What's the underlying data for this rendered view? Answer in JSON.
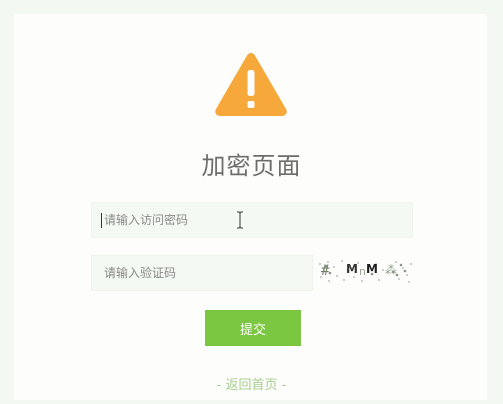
{
  "page": {
    "title": "加密页面"
  },
  "form": {
    "password_placeholder": "请输入访问密码",
    "captcha_placeholder": "请输入验证码",
    "captcha_code": "Mn M"
  },
  "actions": {
    "submit_label": "提交",
    "back_home_label": "- 返回首页 -"
  },
  "icons": {
    "warning": "warning-triangle-icon",
    "cursor": "text-ibeam-cursor-icon"
  },
  "colors": {
    "warning": "#f7a83b",
    "button": "#7cc741",
    "link": "#a8ce8f",
    "title": "#6d6d6d"
  }
}
